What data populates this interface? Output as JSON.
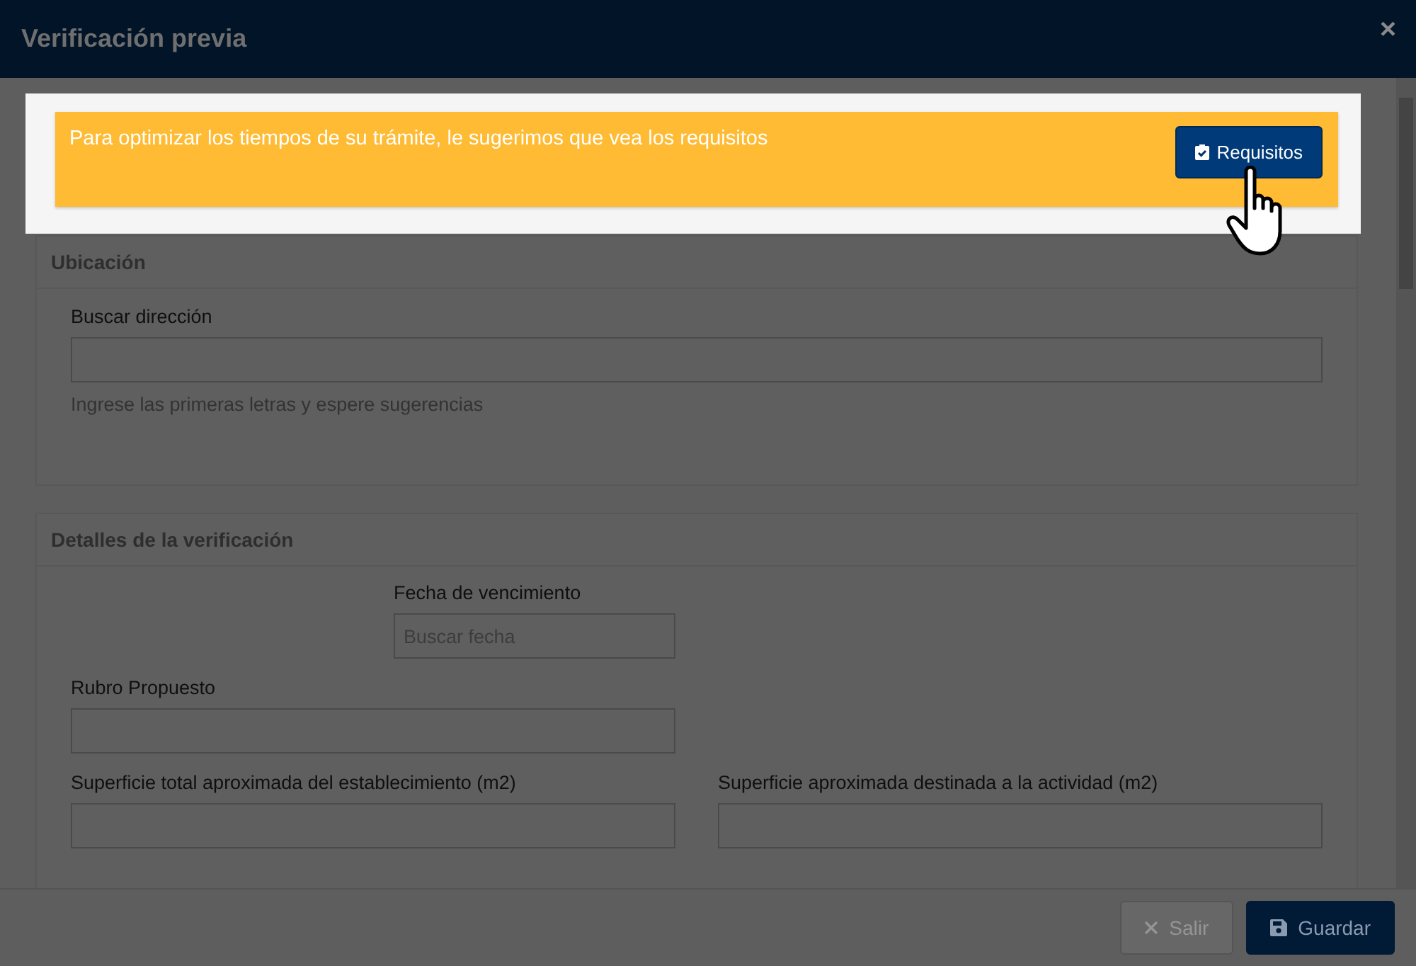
{
  "window": {
    "title": "Verificación previa",
    "close": "×"
  },
  "banner": {
    "message": "Para optimizar los tiempos de su trámite, le sugerimos que vea los requisitos",
    "button": "Requisitos"
  },
  "ubicacion": {
    "title": "Ubicación",
    "label": "Buscar dirección",
    "help": "Ingrese las primeras letras y espere sugerencias"
  },
  "detalles": {
    "title": "Detalles de la verificación",
    "fecha": {
      "label": "Fecha de vencimiento",
      "placeholder": "Buscar fecha"
    },
    "rubro": {
      "label": "Rubro Propuesto"
    },
    "superficie_total": {
      "label": "Superficie total aproximada del establecimiento (m2)"
    },
    "superficie_actividad": {
      "label": "Superficie aproximada destinada a la actividad (m2)"
    }
  },
  "footer": {
    "buttons": [
      {
        "label": "Salir",
        "kind": "cancel",
        "disabled": true
      },
      {
        "label": "Guardar",
        "kind": "save",
        "disabled": false
      }
    ]
  }
}
